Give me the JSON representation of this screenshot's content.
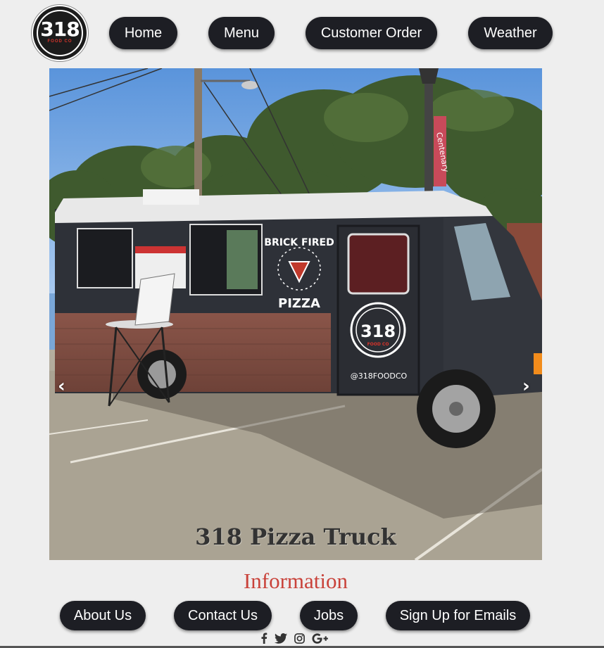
{
  "logo": {
    "number": "318",
    "subtext": "FOOD CO"
  },
  "nav": {
    "home": "Home",
    "menu": "Menu",
    "customer_order": "Customer Order",
    "weather": "Weather"
  },
  "hero": {
    "caption": "318 Pizza Truck",
    "prev_arrow": "‹",
    "next_arrow": "›",
    "truck_text": {
      "brick_fired": "BRICK FIRED",
      "pizza": "PIZZA",
      "badge_number": "318",
      "badge_sub": "FOOD CO",
      "handle": "@318FOODCO",
      "banner": "Centenary"
    }
  },
  "information": {
    "title": "Information",
    "about": "About Us",
    "contact": "Contact Us",
    "jobs": "Jobs",
    "signup": "Sign Up for Emails"
  },
  "social_icons": [
    "facebook-icon",
    "twitter-icon",
    "instagram-icon",
    "google-plus-icon"
  ],
  "colors": {
    "button_bg": "#1d1e24",
    "accent": "#c9423a",
    "page_bg": "#eeeeee"
  }
}
